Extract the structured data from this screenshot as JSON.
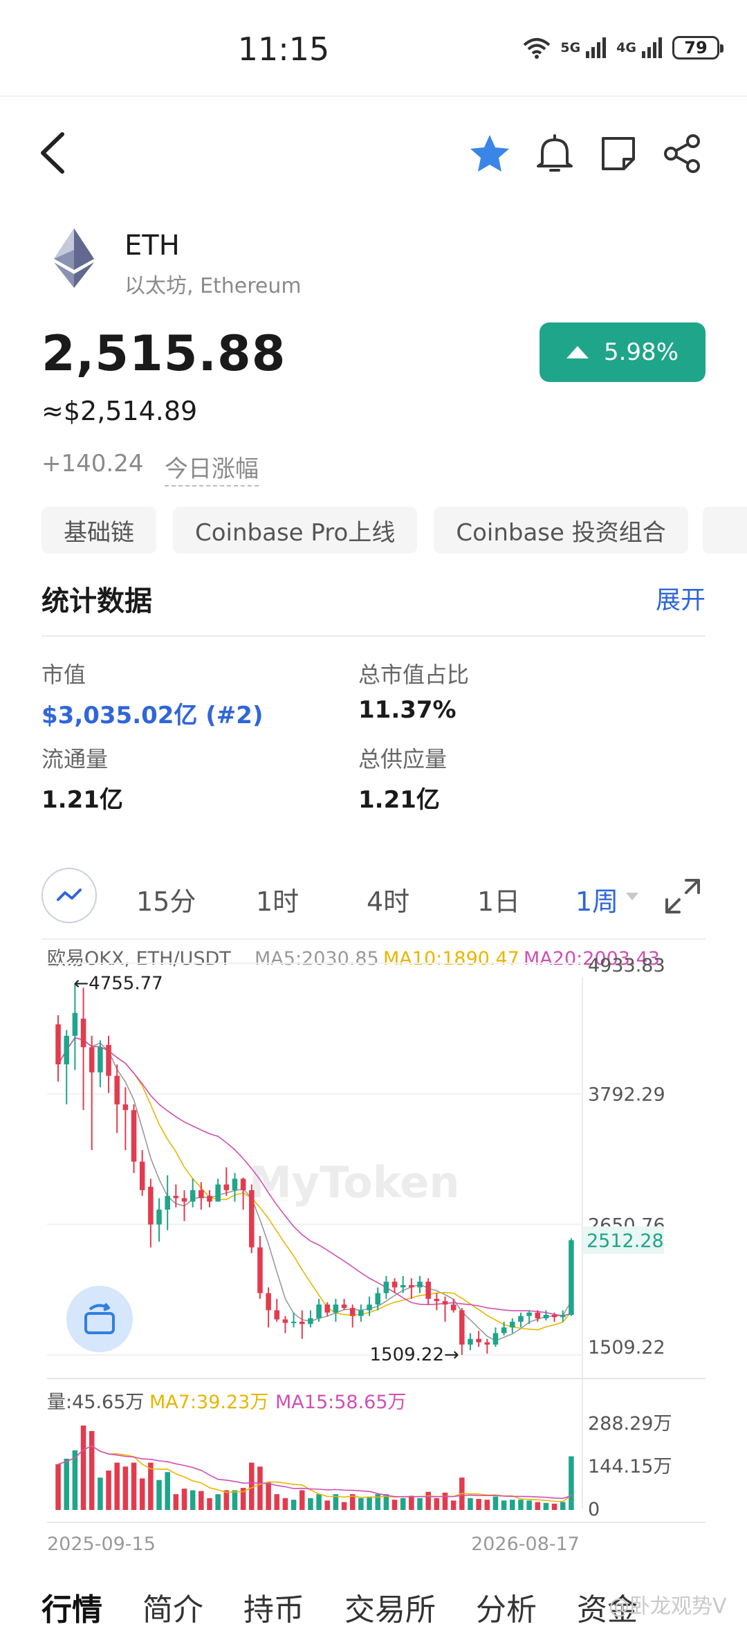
{
  "status_bar": {
    "time": "11:15",
    "net1": "5G",
    "net2": "4G",
    "battery": "79"
  },
  "coin": {
    "symbol": "ETH",
    "name": "以太坊, Ethereum"
  },
  "price": {
    "value": "2,515.88",
    "usd": "≈$2,514.89",
    "change_abs": "+140.24",
    "change_label": "今日涨幅",
    "change_pct": "5.98%",
    "up_color": "#1fa58a"
  },
  "tags": [
    "基础链",
    "Coinbase Pro上线",
    "Coinbase 投资组合"
  ],
  "stats": {
    "title": "统计数据",
    "expand_label": "展开",
    "items": [
      {
        "label": "市值",
        "value": "$3,035.02亿 (#2)"
      },
      {
        "label": "总市值占比",
        "value": "11.37%"
      },
      {
        "label": "流通量",
        "value": "1.21亿"
      },
      {
        "label": "总供应量",
        "value": "1.21亿"
      }
    ]
  },
  "timeframes": {
    "items": [
      "15分",
      "1时",
      "4时",
      "1日",
      "1周"
    ],
    "active": "1周"
  },
  "chart_data": {
    "type": "candlestick",
    "source": "欧易OKX, ETH/USDT",
    "ma_labels": [
      "MA5:2030.85",
      "MA10:1890.47",
      "MA20:2003.43"
    ],
    "ma_colors": [
      "#999999",
      "#e8b600",
      "#d04fb5"
    ],
    "up_color": "#1fa58a",
    "down_color": "#e23b4e",
    "y_ticks": [
      "4933.83",
      "3792.29",
      "2650.76",
      "1509.22"
    ],
    "ylim": [
      1509.22,
      4933.83
    ],
    "high_label": "←4755.77",
    "low_label": "1509.22→",
    "last_price_label": "2512.28",
    "watermark": "MyToken",
    "candles": [
      [
        4400,
        4050,
        4480,
        3900
      ],
      [
        4050,
        4300,
        4350,
        3700
      ],
      [
        4300,
        4500,
        4755.77,
        4000
      ],
      [
        4450,
        4200,
        4720,
        3650
      ],
      [
        4200,
        3980,
        4300,
        3300
      ],
      [
        3980,
        4200,
        4260,
        3850
      ],
      [
        4220,
        3950,
        4300,
        3800
      ],
      [
        3950,
        3700,
        4050,
        3450
      ],
      [
        3700,
        3650,
        3850,
        3300
      ],
      [
        3650,
        3200,
        3700,
        3100
      ],
      [
        3200,
        2950,
        3300,
        2900
      ],
      [
        2980,
        2650,
        3050,
        2450
      ],
      [
        2650,
        2780,
        2880,
        2500
      ],
      [
        2780,
        2900,
        3080,
        2600
      ],
      [
        2900,
        2880,
        3000,
        2800
      ],
      [
        2880,
        2850,
        2950,
        2680
      ],
      [
        2850,
        2950,
        3050,
        2800
      ],
      [
        2950,
        2880,
        3020,
        2780
      ],
      [
        2900,
        2850,
        2950,
        2800
      ],
      [
        2850,
        3000,
        3050,
        2850
      ],
      [
        3000,
        2950,
        3150,
        2900
      ],
      [
        2950,
        3050,
        3100,
        2850
      ],
      [
        3050,
        2950,
        3060,
        2780
      ],
      [
        2950,
        2450,
        3000,
        2400
      ],
      [
        2450,
        2050,
        2550,
        2000
      ],
      [
        2050,
        1900,
        2100,
        1750
      ],
      [
        1900,
        1820,
        2000,
        1800
      ],
      [
        1820,
        1790,
        1850,
        1700
      ],
      [
        1790,
        1800,
        1880,
        1750
      ],
      [
        1800,
        1780,
        1900,
        1650
      ],
      [
        1780,
        1830,
        1900,
        1750
      ],
      [
        1830,
        1950,
        2000,
        1800
      ],
      [
        1950,
        1880,
        1970,
        1850
      ],
      [
        1880,
        1950,
        2000,
        1800
      ],
      [
        1950,
        1920,
        2000,
        1900
      ],
      [
        1920,
        1850,
        1950,
        1750
      ],
      [
        1850,
        1900,
        1950,
        1800
      ],
      [
        1900,
        1950,
        2020,
        1850
      ],
      [
        1950,
        2050,
        2100,
        1900
      ],
      [
        2050,
        2150,
        2200,
        2000
      ],
      [
        2150,
        2100,
        2180,
        2050
      ],
      [
        2100,
        2120,
        2200,
        2050
      ],
      [
        2120,
        2100,
        2180,
        2000
      ],
      [
        2100,
        2150,
        2200,
        2050
      ],
      [
        2150,
        2000,
        2180,
        1950
      ],
      [
        2000,
        1980,
        2050,
        1900
      ],
      [
        1980,
        1950,
        2020,
        1800
      ],
      [
        1950,
        1900,
        2000,
        1880
      ],
      [
        1900,
        1600,
        1920,
        1509.22
      ],
      [
        1600,
        1650,
        1700,
        1550
      ],
      [
        1650,
        1620,
        1720,
        1580
      ],
      [
        1620,
        1600,
        1650,
        1520
      ],
      [
        1600,
        1700,
        1750,
        1580
      ],
      [
        1700,
        1750,
        1800,
        1680
      ],
      [
        1750,
        1800,
        1830,
        1700
      ],
      [
        1800,
        1850,
        1880,
        1750
      ],
      [
        1850,
        1880,
        1900,
        1780
      ],
      [
        1880,
        1830,
        1900,
        1800
      ],
      [
        1830,
        1860,
        1900,
        1810
      ],
      [
        1860,
        1840,
        1880,
        1800
      ],
      [
        1840,
        1860,
        1900,
        1800
      ],
      [
        1860,
        2512.28,
        2530,
        1850
      ]
    ],
    "volume": {
      "title": "量:45.65万",
      "ma_labels": [
        "MA7:39.23万",
        "MA15:58.65万"
      ],
      "y_ticks": [
        "288.29万",
        "144.15万",
        "0"
      ],
      "ylim": [
        0,
        288.29
      ]
    },
    "x_labels": [
      "2025-09-15",
      "2026-08-17"
    ]
  },
  "bottom_tabs": {
    "items": [
      "行情",
      "简介",
      "持币",
      "交易所",
      "分析",
      "资金"
    ],
    "active": "行情"
  },
  "weibo_watermark": "@卧龙观势V"
}
